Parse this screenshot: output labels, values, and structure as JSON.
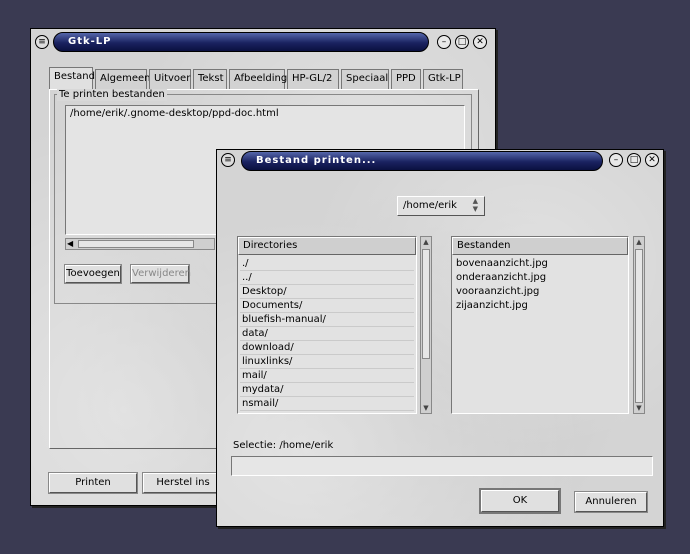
{
  "main_window": {
    "title": "Gtk-LP",
    "tabs": [
      {
        "label": "Bestand",
        "active": true
      },
      {
        "label": "Algemeen"
      },
      {
        "label": "Uitvoer"
      },
      {
        "label": "Tekst"
      },
      {
        "label": "Afbeelding"
      },
      {
        "label": "HP-GL/2"
      },
      {
        "label": "Speciaal"
      },
      {
        "label": "PPD"
      },
      {
        "label": "Gtk-LP"
      }
    ],
    "files_group_label": "Te printen bestanden",
    "files": [
      "/home/erik/.gnome-desktop/ppd-doc.html"
    ],
    "add_button": "Toevoegen",
    "remove_button": "Verwijderen",
    "print_button": "Printen",
    "reset_button": "Herstel ins"
  },
  "dialog": {
    "title": "Bestand printen...",
    "path_selector": "/home/erik",
    "directories_header": "Directories",
    "directories": [
      "./",
      "../",
      "Desktop/",
      "Documents/",
      "bluefish-manual/",
      "data/",
      "download/",
      "linuxlinks/",
      "mail/",
      "mydata/",
      "nsmail/"
    ],
    "files_header": "Bestanden",
    "files": [
      "bovenaanzicht.jpg",
      "onderaanzicht.jpg",
      "vooraanzicht.jpg",
      "zijaanzicht.jpg"
    ],
    "selection_label": "Selectie: /home/erik",
    "selection_value": "",
    "ok_button": "OK",
    "cancel_button": "Annuleren"
  },
  "icons": {
    "window_menu": "window-menu-icon",
    "minimize": "minimize-icon",
    "maximize": "maximize-icon",
    "close": "close-icon"
  }
}
